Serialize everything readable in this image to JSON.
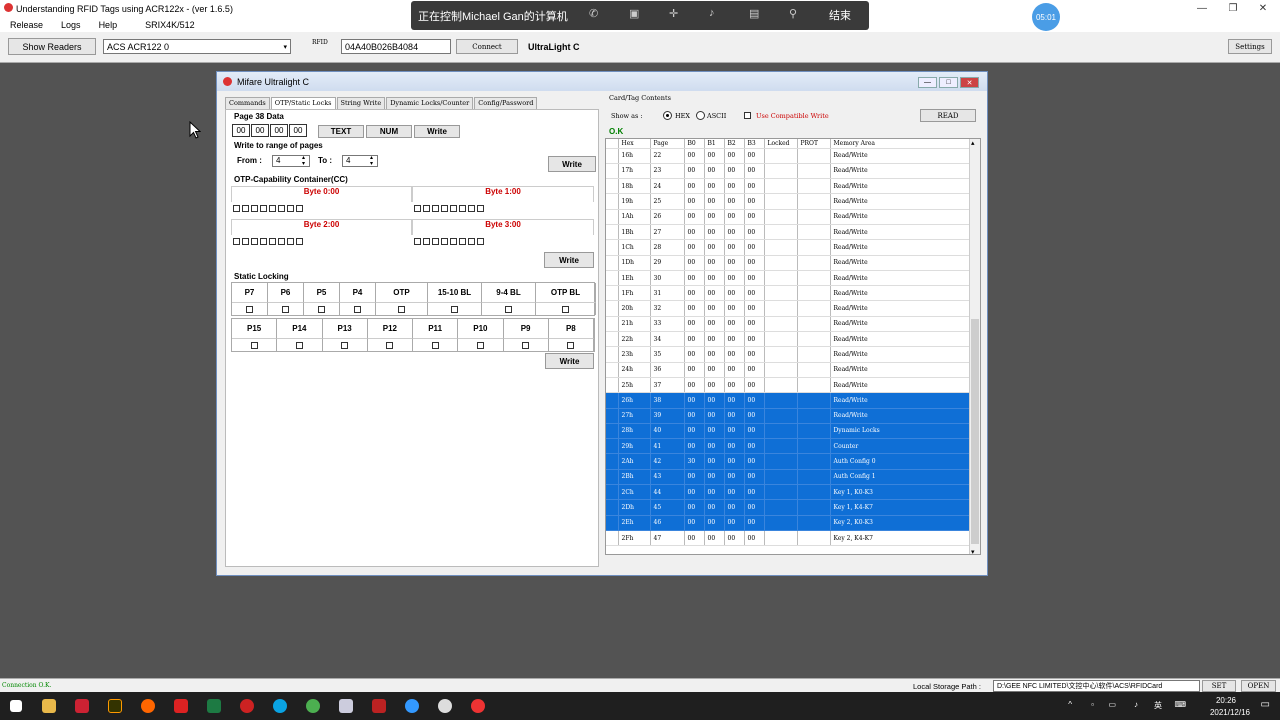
{
  "window": {
    "title": "Understanding RFID Tags using ACR122x - (ver 1.6.5)"
  },
  "menu": [
    "Release",
    "Logs",
    "Help",
    "SRIX4K/512"
  ],
  "toolbar": {
    "show_readers": "Show Readers",
    "reader": "ACS ACR122 0",
    "rfid_label": "RFID",
    "rfid_value": "04A40B026B4084",
    "connect": "Connect",
    "card_type": "UltraLight C",
    "settings": "Settings"
  },
  "remote": {
    "label": "正在控制Michael Gan的计算机",
    "end": "结束",
    "icons": [
      "phone-icon",
      "window-icon",
      "fit-icon",
      "volume-icon",
      "hd-icon",
      "pin-icon"
    ]
  },
  "timer": "05:01",
  "child": {
    "title": "Mifare Ultralight C"
  },
  "tabs": [
    "Commands",
    "OTP/Static Locks",
    "String Write",
    "Dynamic Locks/Counter",
    "Config/Password"
  ],
  "page38": {
    "title": "Page 38 Data",
    "bytes": [
      "00",
      "00",
      "00",
      "00"
    ],
    "text_btn": "TEXT",
    "num_btn": "NUM",
    "write_btn": "Write"
  },
  "range": {
    "title": "Write to range of pages",
    "from_label": "From :",
    "from_value": "4",
    "to_label": "To :",
    "to_value": "4",
    "write_btn": "Write"
  },
  "otp": {
    "title": "OTP-Capability Container(CC)",
    "bytes": [
      "Byte 0:00",
      "Byte 1:00",
      "Byte 2:00",
      "Byte 3:00"
    ],
    "write_btn": "Write"
  },
  "static": {
    "title": "Static Locking",
    "row1": [
      "P7",
      "P6",
      "P5",
      "P4",
      "OTP",
      "15-10 BL",
      "9-4 BL",
      "OTP BL"
    ],
    "row2": [
      "P15",
      "P14",
      "P13",
      "P12",
      "P11",
      "P10",
      "P9",
      "P8"
    ],
    "write_btn": "Write"
  },
  "card": {
    "title": "Card/Tag Contents",
    "show_as": "Show as :",
    "hex": "HEX",
    "ascii": "ASCII",
    "compat": "Use Compatible Write",
    "read_btn": "READ",
    "status": "O.K"
  },
  "table": {
    "headers": [
      "Hex",
      "Page",
      "B0",
      "B1",
      "B2",
      "B3",
      "Locked",
      "PROT",
      "Memory Area"
    ],
    "rows": [
      [
        "16h",
        "22",
        "00",
        "00",
        "00",
        "00",
        "",
        "",
        "Read/Write",
        false
      ],
      [
        "17h",
        "23",
        "00",
        "00",
        "00",
        "00",
        "",
        "",
        "Read/Write",
        false
      ],
      [
        "18h",
        "24",
        "00",
        "00",
        "00",
        "00",
        "",
        "",
        "Read/Write",
        false
      ],
      [
        "19h",
        "25",
        "00",
        "00",
        "00",
        "00",
        "",
        "",
        "Read/Write",
        false
      ],
      [
        "1Ah",
        "26",
        "00",
        "00",
        "00",
        "00",
        "",
        "",
        "Read/Write",
        false
      ],
      [
        "1Bh",
        "27",
        "00",
        "00",
        "00",
        "00",
        "",
        "",
        "Read/Write",
        false
      ],
      [
        "1Ch",
        "28",
        "00",
        "00",
        "00",
        "00",
        "",
        "",
        "Read/Write",
        false
      ],
      [
        "1Dh",
        "29",
        "00",
        "00",
        "00",
        "00",
        "",
        "",
        "Read/Write",
        false
      ],
      [
        "1Eh",
        "30",
        "00",
        "00",
        "00",
        "00",
        "",
        "",
        "Read/Write",
        false
      ],
      [
        "1Fh",
        "31",
        "00",
        "00",
        "00",
        "00",
        "",
        "",
        "Read/Write",
        false
      ],
      [
        "20h",
        "32",
        "00",
        "00",
        "00",
        "00",
        "",
        "",
        "Read/Write",
        false
      ],
      [
        "21h",
        "33",
        "00",
        "00",
        "00",
        "00",
        "",
        "",
        "Read/Write",
        false
      ],
      [
        "22h",
        "34",
        "00",
        "00",
        "00",
        "00",
        "",
        "",
        "Read/Write",
        false
      ],
      [
        "23h",
        "35",
        "00",
        "00",
        "00",
        "00",
        "",
        "",
        "Read/Write",
        false
      ],
      [
        "24h",
        "36",
        "00",
        "00",
        "00",
        "00",
        "",
        "",
        "Read/Write",
        false
      ],
      [
        "25h",
        "37",
        "00",
        "00",
        "00",
        "00",
        "",
        "",
        "Read/Write",
        false
      ],
      [
        "26h",
        "38",
        "00",
        "00",
        "00",
        "00",
        "",
        "",
        "Read/Write",
        true
      ],
      [
        "27h",
        "39",
        "00",
        "00",
        "00",
        "00",
        "",
        "",
        "Read/Write",
        true
      ],
      [
        "28h",
        "40",
        "00",
        "00",
        "00",
        "00",
        "",
        "",
        "Dynamic Locks",
        true
      ],
      [
        "29h",
        "41",
        "00",
        "00",
        "00",
        "00",
        "",
        "",
        "Counter",
        true
      ],
      [
        "2Ah",
        "42",
        "30",
        "00",
        "00",
        "00",
        "",
        "",
        "Auth Config 0",
        true
      ],
      [
        "2Bh",
        "43",
        "00",
        "00",
        "00",
        "00",
        "",
        "",
        "Auth Config 1",
        true
      ],
      [
        "2Ch",
        "44",
        "00",
        "00",
        "00",
        "00",
        "",
        "",
        "Key 1, K0-K3",
        true
      ],
      [
        "2Dh",
        "45",
        "00",
        "00",
        "00",
        "00",
        "",
        "",
        "Key 1, K4-K7",
        true
      ],
      [
        "2Eh",
        "46",
        "00",
        "00",
        "00",
        "00",
        "",
        "",
        "Key 2, K0-K3",
        true
      ],
      [
        "2Fh",
        "47",
        "00",
        "00",
        "00",
        "00",
        "",
        "",
        "Key 2, K4-K7",
        false
      ]
    ]
  },
  "status": {
    "connection": "Connection O.K.",
    "storage_label": "Local Storage Path :",
    "storage_path": "D:\\GEE NFC LIMITED\\文控中心\\软件\\ACS\\RFIDCard",
    "set_btn": "SET",
    "open_btn": "OPEN"
  },
  "tray": {
    "lang": "英",
    "time": "20:26",
    "date": "2021/12/16"
  },
  "colors": {
    "selection": "#0f6fd6",
    "byte_header": "#cc0000",
    "status_ok": "#008000"
  }
}
